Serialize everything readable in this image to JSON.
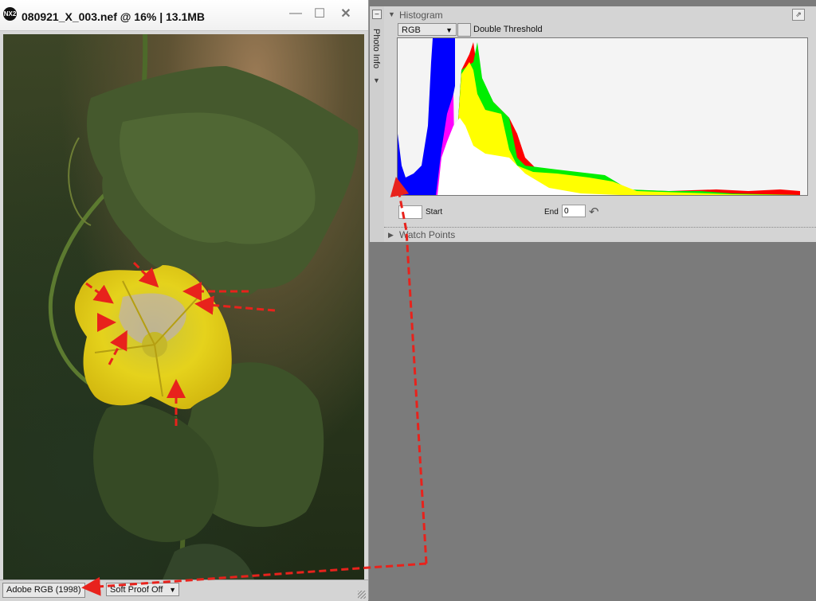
{
  "window": {
    "app_logo": "NX2",
    "title": "080921_X_003.nef @ 16% | 13.1MB",
    "controls": {
      "minimize": "—",
      "maximize": "☐",
      "close": "✕"
    }
  },
  "status_bar": {
    "color_profile": "Adobe RGB (1998)",
    "soft_proof": "Soft Proof Off",
    "soft_proof_arrow": "▼"
  },
  "side_strip": {
    "collapse": "–",
    "label": "Photo Info",
    "arrow": "▼"
  },
  "histogram_panel": {
    "collapse_triangle": "▼",
    "title": "Histogram",
    "popout": "⇗",
    "channel": {
      "selected": "RGB",
      "arrow": "▼"
    },
    "double_threshold": {
      "label": "Double Threshold",
      "checked": false
    },
    "start": {
      "label": "Start",
      "value": ""
    },
    "end": {
      "label": "End",
      "value": "0"
    },
    "reset_icon": "↶",
    "colors": {
      "white": "#ffffff",
      "yellow": "#ffff00",
      "green": "#00ee00",
      "red": "#ff0000",
      "blue": "#0000ff",
      "magenta": "#ff00ff"
    }
  },
  "watch_points": {
    "triangle": "▶",
    "title": "Watch Points"
  },
  "annotation_color": "#e8221c"
}
